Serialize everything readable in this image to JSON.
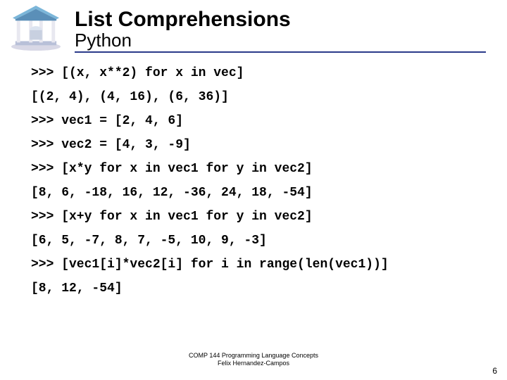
{
  "header": {
    "title": "List Comprehensions",
    "subtitle": "Python"
  },
  "code": {
    "lines": [
      ">>> [(x, x**2) for x in vec]",
      "[(2, 4), (4, 16), (6, 36)]",
      ">>> vec1 = [2, 4, 6]",
      ">>> vec2 = [4, 3, -9]",
      ">>> [x*y for x in vec1 for y in vec2]",
      "[8, 6, -18, 16, 12, -36, 24, 18, -54]",
      ">>> [x+y for x in vec1 for y in vec2]",
      "[6, 5, -7, 8, 7, -5, 10, 9, -3]",
      ">>> [vec1[i]*vec2[i] for i in range(len(vec1))]",
      "[8, 12, -54]"
    ]
  },
  "footer": {
    "line1": "COMP 144 Programming Language Concepts",
    "line2": "Felix Hernandez-Campos"
  },
  "page": "6"
}
